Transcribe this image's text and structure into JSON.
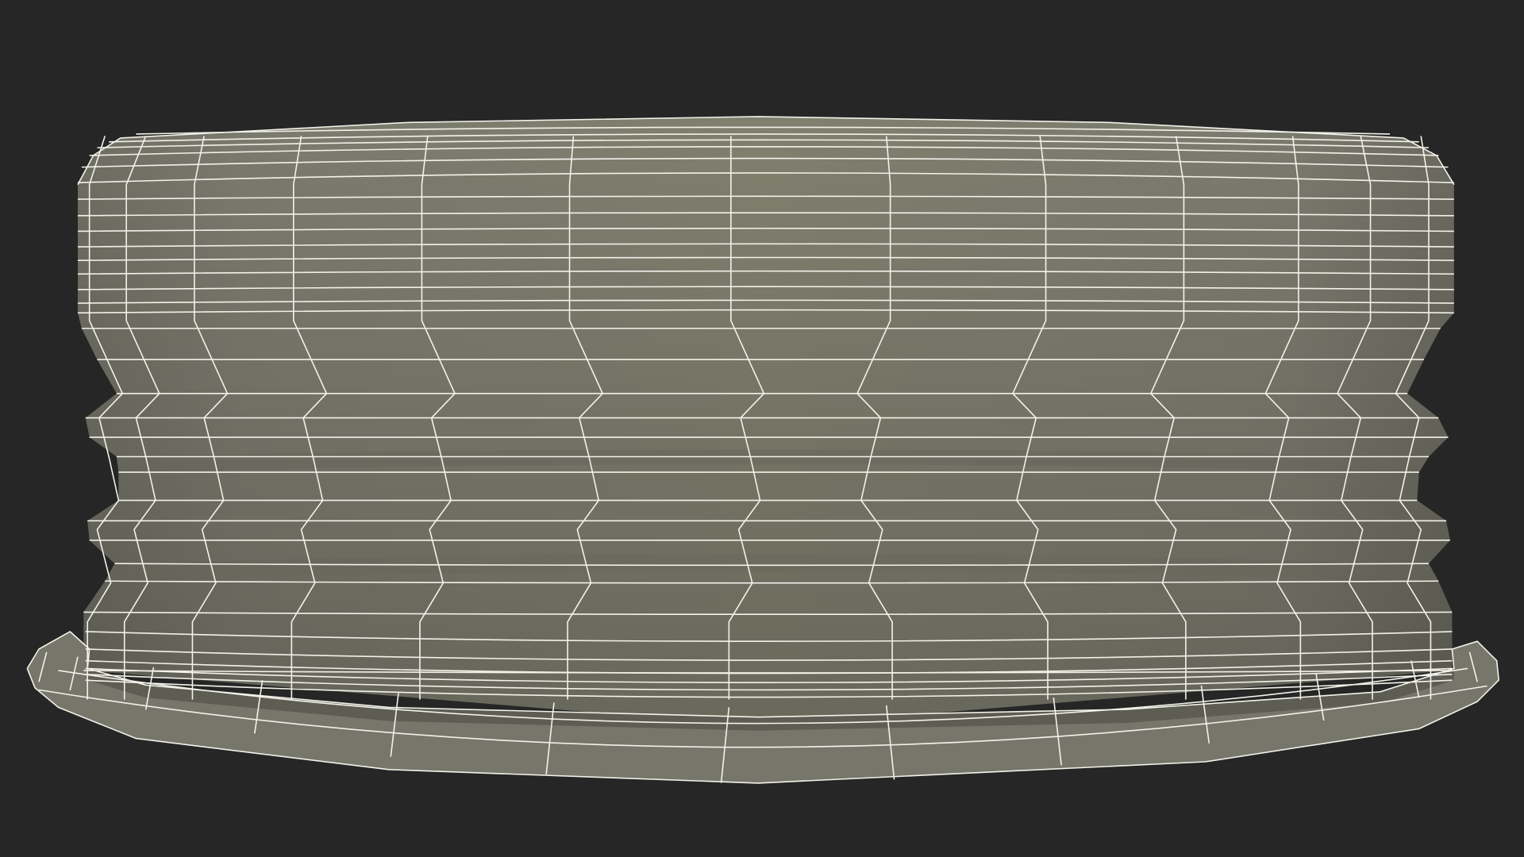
{
  "scene": {
    "background_color": "#262626",
    "subject": "3d-wireframe-cap-mesh",
    "surface_color": "#7c7c70",
    "surface_shadow_color": "#66665c",
    "wire_color": "#f2f2ea"
  }
}
